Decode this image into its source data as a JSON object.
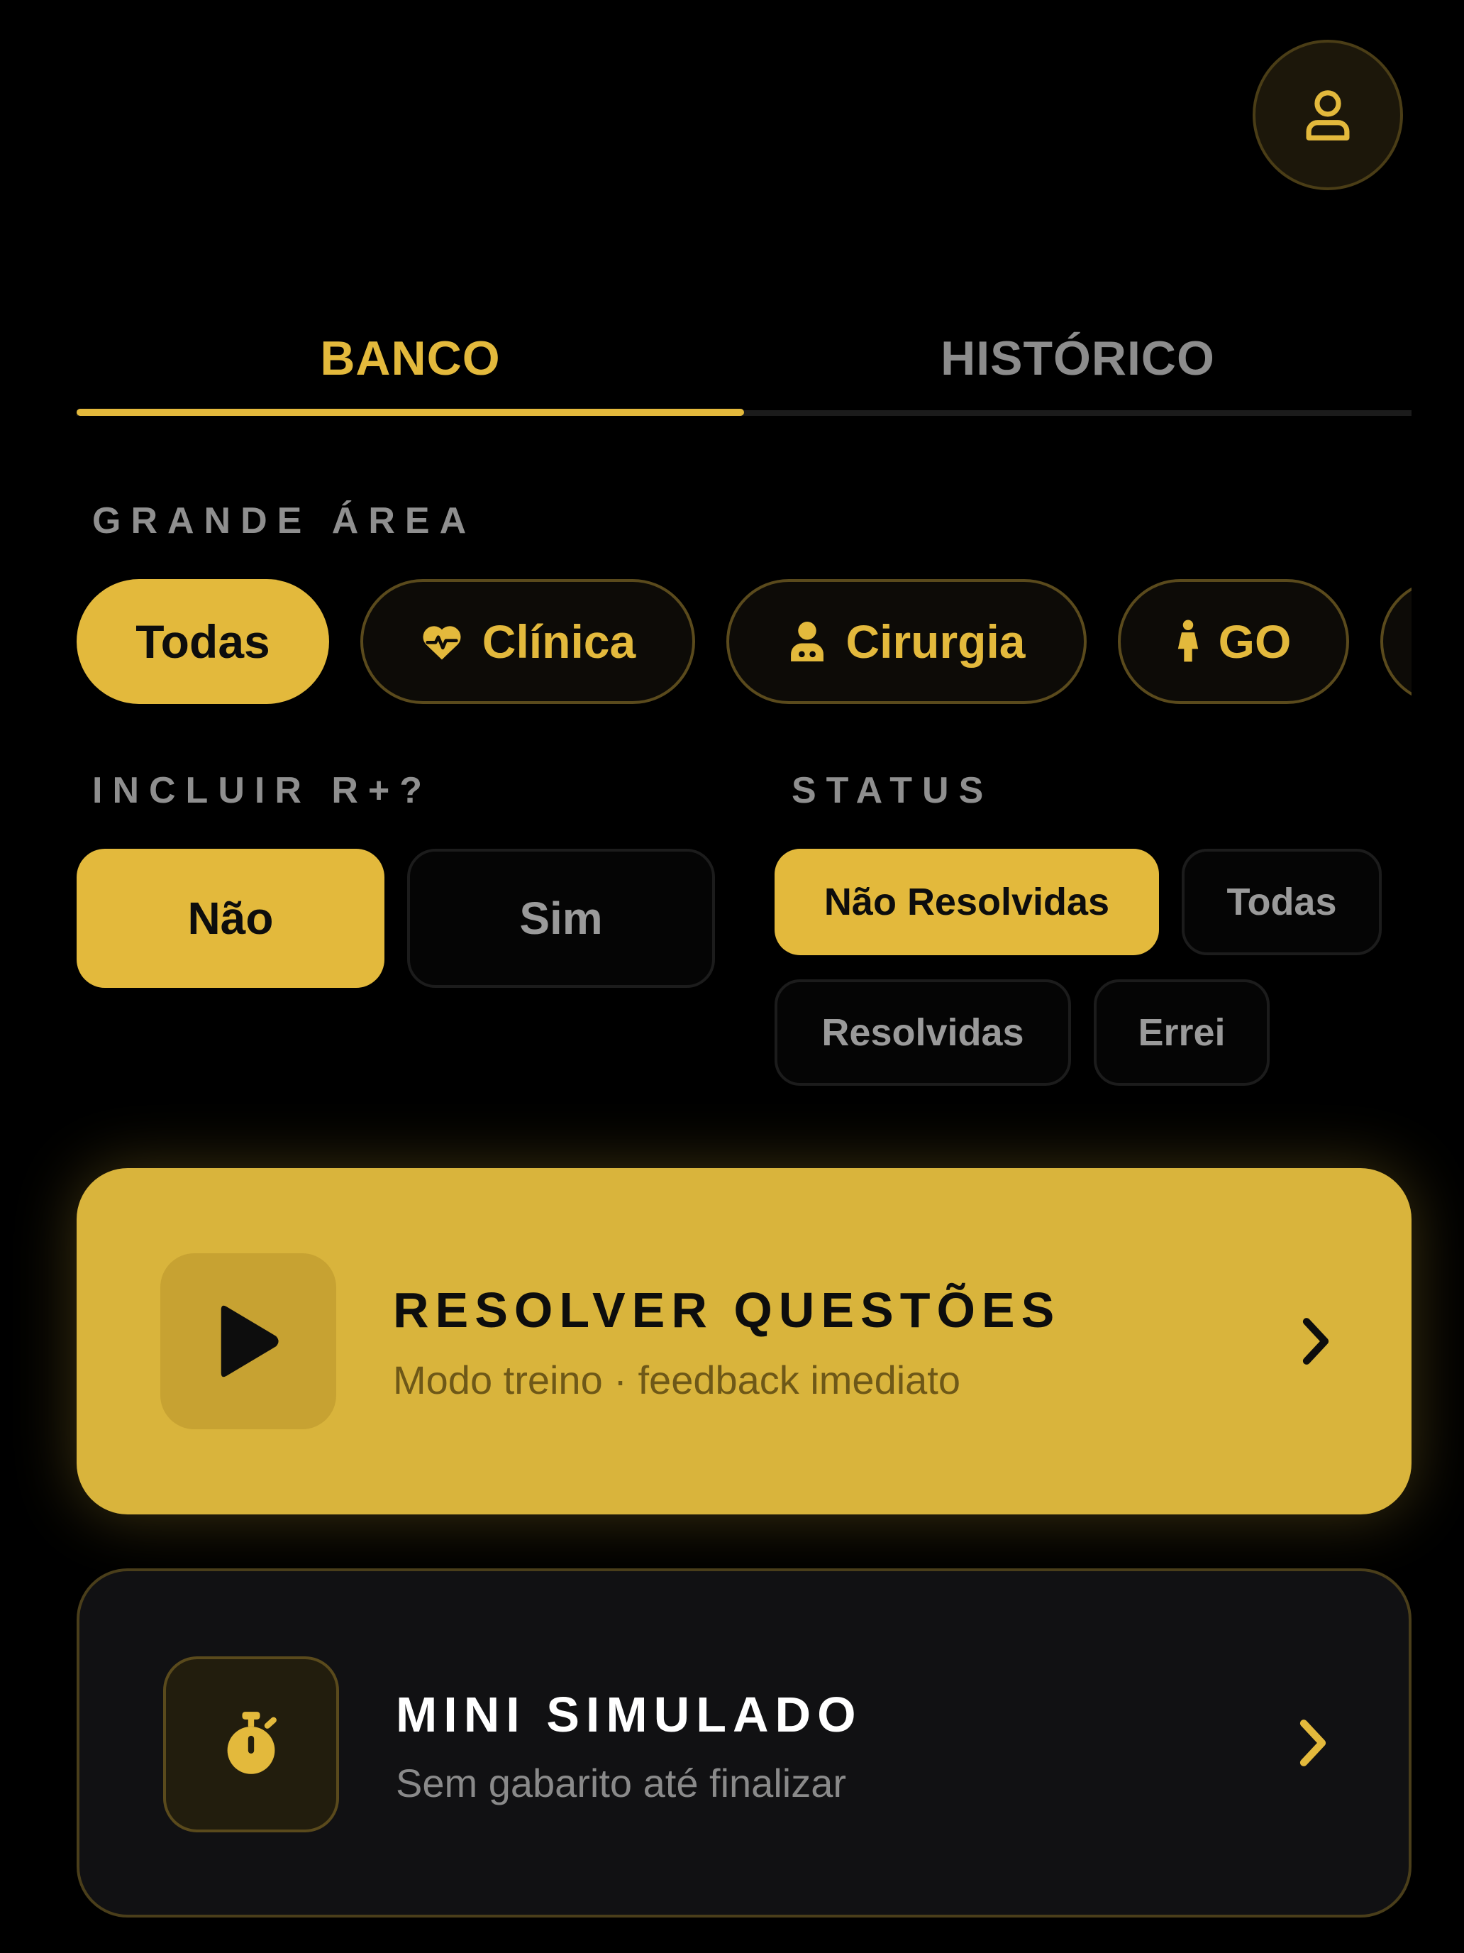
{
  "header": {
    "profile_icon": "user-icon"
  },
  "tabs": [
    {
      "label": "BANCO",
      "active": true
    },
    {
      "label": "HISTÓRICO",
      "active": false
    }
  ],
  "grande_area": {
    "label": "GRANDE ÁREA",
    "chips": [
      {
        "label": "Todas",
        "icon": "",
        "selected": true
      },
      {
        "label": "Clínica",
        "icon": "heart-pulse-icon",
        "selected": false
      },
      {
        "label": "Cirurgia",
        "icon": "surgeon-icon",
        "selected": false
      },
      {
        "label": "GO",
        "icon": "woman-icon",
        "selected": false
      }
    ]
  },
  "incluir_r": {
    "label": "INCLUIR R+?",
    "options": [
      {
        "label": "Não",
        "selected": true
      },
      {
        "label": "Sim",
        "selected": false
      }
    ]
  },
  "status": {
    "label": "STATUS",
    "options": [
      {
        "label": "Não Resolvidas",
        "selected": true
      },
      {
        "label": "Todas",
        "selected": false
      },
      {
        "label": "Resolvidas",
        "selected": false
      },
      {
        "label": "Errei",
        "selected": false
      }
    ]
  },
  "actions": {
    "resolver": {
      "title": "RESOLVER QUESTÕES",
      "subtitle": "Modo treino · feedback imediato",
      "icon": "play-icon"
    },
    "simulado": {
      "title": "MINI SIMULADO",
      "subtitle": "Sem gabarito até finalizar",
      "icon": "stopwatch-icon"
    }
  },
  "colors": {
    "accent": "#e3b93c",
    "background": "#000000",
    "muted": "#8f8f8f"
  }
}
